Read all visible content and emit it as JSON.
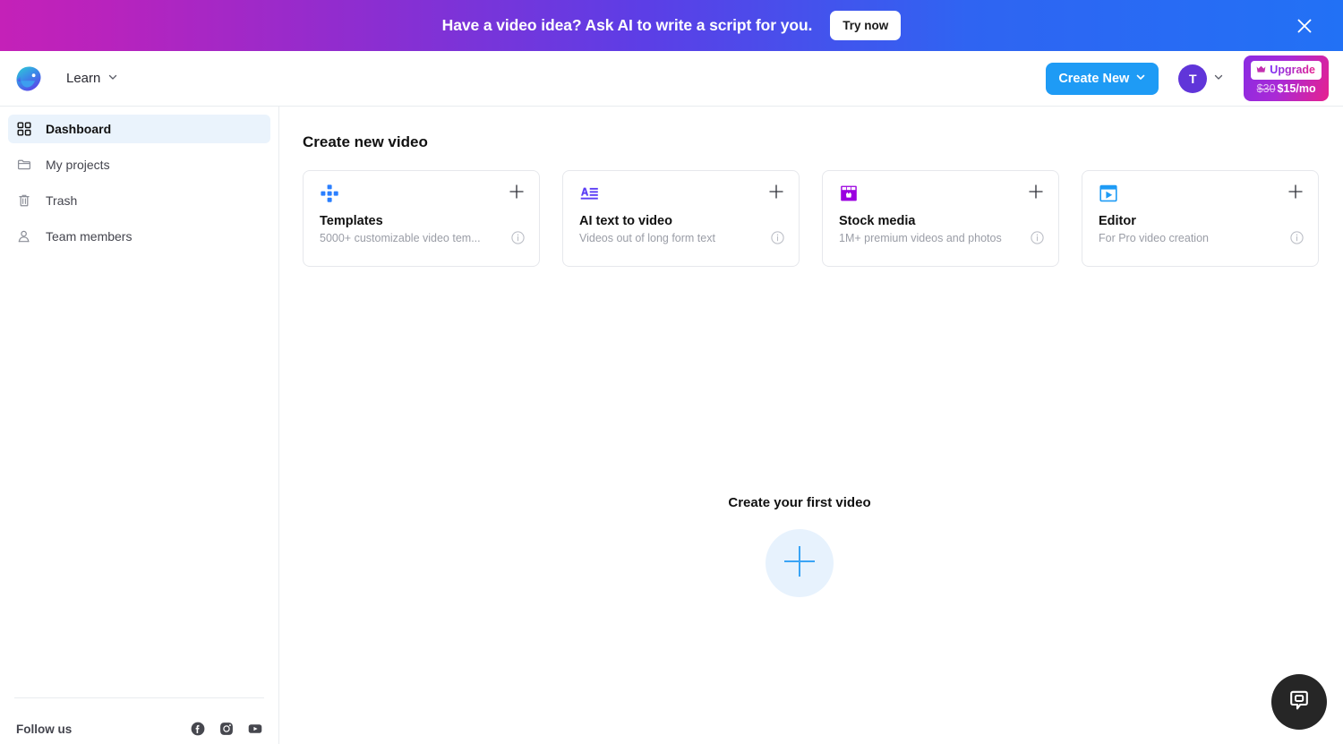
{
  "promo": {
    "text": "Have a video idea? Ask AI to write a script for you.",
    "button_label": "Try now",
    "close_icon": "close-icon",
    "gradient_from": "#c421b8",
    "gradient_to": "#2271f5"
  },
  "header": {
    "logo_icon": "app-logo-icon",
    "learn_label": "Learn",
    "learn_chevron_icon": "chevron-down-icon",
    "create_new_label": "Create New",
    "create_new_chevron_icon": "chevron-down-icon",
    "create_new_color": "#1e9bf5",
    "avatar_initial": "T",
    "avatar_color": "#6035d9",
    "avatar_chevron_icon": "chevron-down-icon",
    "upgrade": {
      "crown_icon": "crown-icon",
      "label": "Upgrade",
      "old_price": "$30",
      "new_price": "$15/mo"
    }
  },
  "sidebar": {
    "items": [
      {
        "label": "Dashboard",
        "icon": "grid-icon",
        "active": true
      },
      {
        "label": "My projects",
        "icon": "folder-icon",
        "active": false
      },
      {
        "label": "Trash",
        "icon": "trash-icon",
        "active": false
      },
      {
        "label": "Team members",
        "icon": "users-icon",
        "active": false
      }
    ],
    "follow_label": "Follow us",
    "socials": [
      {
        "name": "facebook-icon"
      },
      {
        "name": "instagram-icon"
      },
      {
        "name": "youtube-icon"
      }
    ]
  },
  "main": {
    "title": "Create new video",
    "cards": [
      {
        "title": "Templates",
        "subtitle": "5000+ customizable video tem...",
        "icon": "templates-grid-icon",
        "icon_color": "#2a7fff",
        "plus_icon": "plus-icon",
        "info_icon": "info-icon"
      },
      {
        "title": "AI text to video",
        "subtitle": "Videos out of long form text",
        "icon": "text-to-video-icon",
        "icon_color": "#5b3df5",
        "plus_icon": "plus-icon",
        "info_icon": "info-icon"
      },
      {
        "title": "Stock media",
        "subtitle": "1M+ premium videos and photos",
        "icon": "stock-media-icon",
        "icon_color": "#9b00e0",
        "plus_icon": "plus-icon",
        "info_icon": "info-icon"
      },
      {
        "title": "Editor",
        "subtitle": "For Pro video creation",
        "icon": "editor-play-icon",
        "icon_color": "#1e9bf5",
        "plus_icon": "plus-icon",
        "info_icon": "info-icon"
      }
    ],
    "empty_state": {
      "title": "Create your first video",
      "plus_icon": "plus-icon",
      "circle_color": "#e7f2fd",
      "plus_color": "#3aa4f5"
    }
  },
  "chat": {
    "launcher_icon": "chat-bubble-icon",
    "launcher_color": "#262626"
  }
}
